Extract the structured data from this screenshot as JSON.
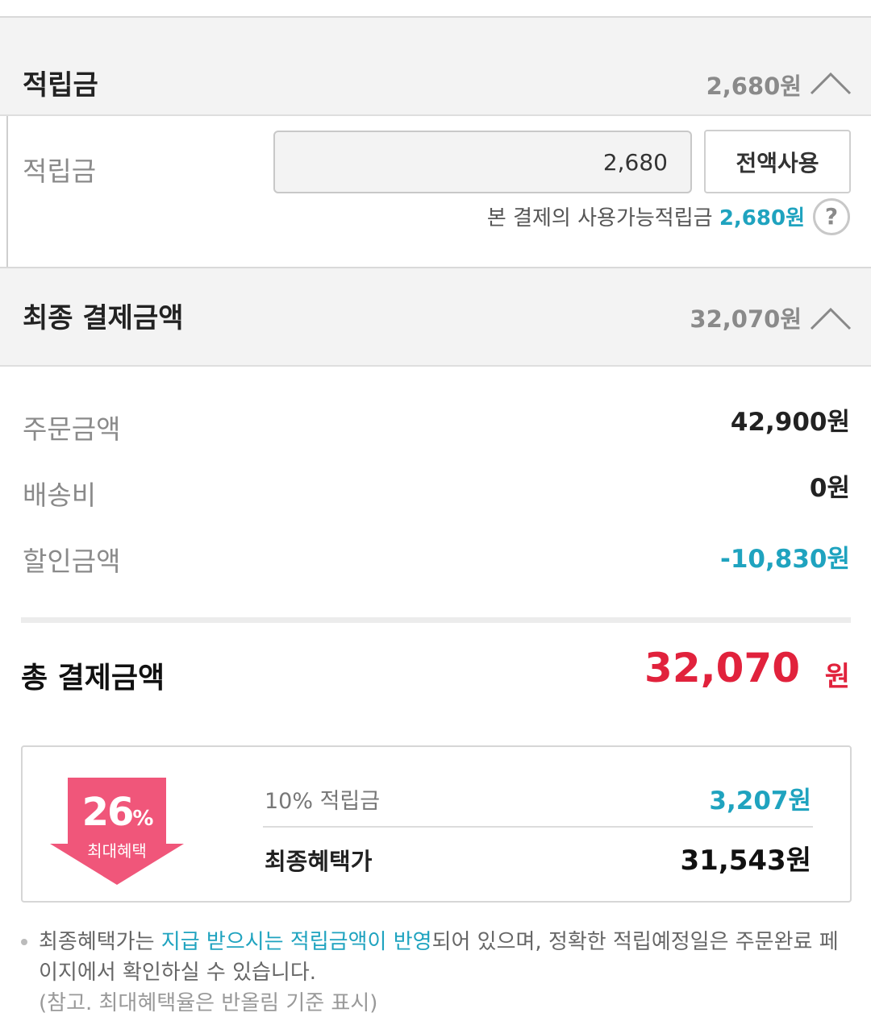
{
  "points_section": {
    "title": "적립금",
    "header_amount": "2,680원",
    "field_label": "적립금",
    "input_value": "2,680",
    "use_all_label": "전액사용",
    "available_text": "본 결제의 사용가능적립금",
    "available_value": "2,680원",
    "help_symbol": "?"
  },
  "final_section": {
    "title": "최종 결제금액",
    "header_amount": "32,070원",
    "rows": [
      {
        "label": "주문금액",
        "value": "42,900원"
      },
      {
        "label": "배송비",
        "value": "0원"
      },
      {
        "label": "할인금액",
        "value": "-10,830원"
      }
    ],
    "total_label": "총 결제금액",
    "total_amount": "32,070",
    "total_unit": "원"
  },
  "benefit": {
    "badge_percent": "26",
    "badge_percent_sign": "%",
    "badge_text": "최대혜택",
    "points_label": "10% 적립금",
    "points_value": "3,207원",
    "final_label": "최종혜택가",
    "final_value": "31,543원"
  },
  "note": {
    "part1": "최종혜택가는 ",
    "highlight": "지급 받으시는 적립금액이 반영",
    "part2": "되어 있으며, 정확한 적립예정일은 주문완료 페이지에서 확인하실 수 있습니다.",
    "sub": "(참고. 최대혜택율은 반올림 기준 표시)"
  },
  "colors": {
    "accent_blue": "#1fa3bf",
    "total_red": "#e1223c",
    "badge_pink": "#f0567a"
  }
}
